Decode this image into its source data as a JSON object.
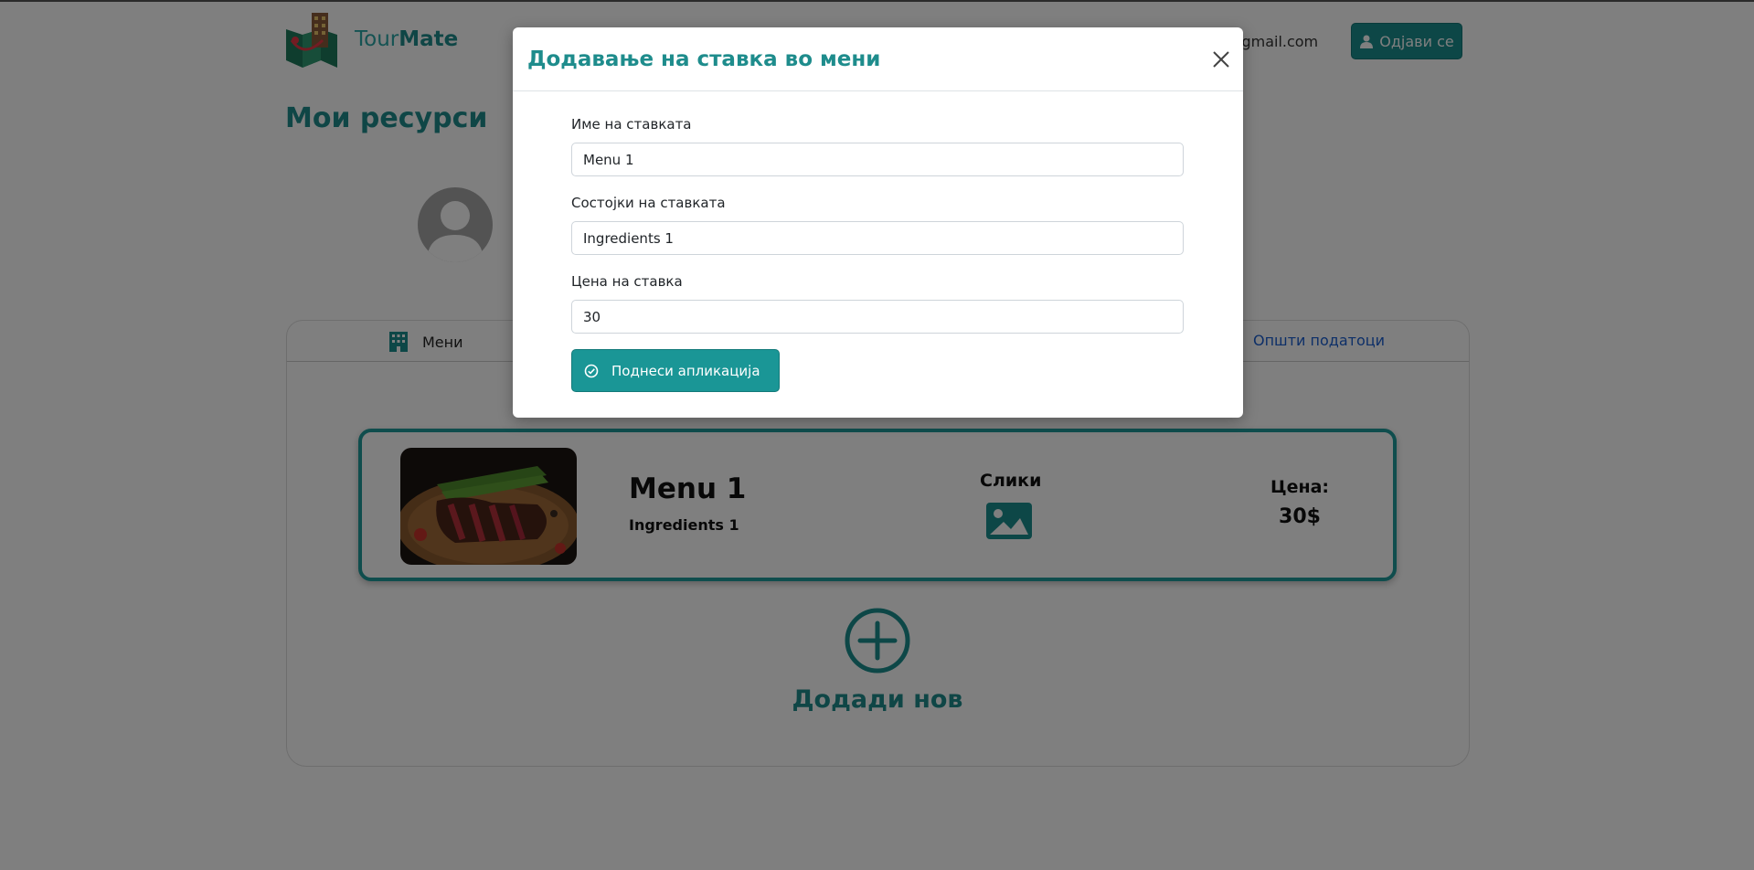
{
  "header": {
    "brand_part1": "Tour",
    "brand_part2": "Mate",
    "email": "i@gmail.com",
    "logout_label": "Одјави се"
  },
  "page": {
    "title": "Мои ресурси"
  },
  "tabs": {
    "menu_label": "Мени",
    "general_label": "Општи податоци"
  },
  "menu_item": {
    "name": "Menu 1",
    "ingredients": "Ingredients 1",
    "pictures_label": "Слики",
    "price_label": "Цена:",
    "price_value": "30$"
  },
  "add_new": {
    "label": "Додади нов"
  },
  "modal": {
    "title": "Додавање на ставка во мени",
    "name_label": "Име на ставката",
    "name_value": "Menu 1",
    "ingredients_label": "Состојки на ставката",
    "ingredients_value": "Ingredients 1",
    "price_label": "Цена на ставка",
    "price_value": "30",
    "submit_label": "Поднеси апликација"
  },
  "colors": {
    "accent": "#1e8c8c",
    "button": "#1a9696",
    "link": "#1a5fd0"
  }
}
